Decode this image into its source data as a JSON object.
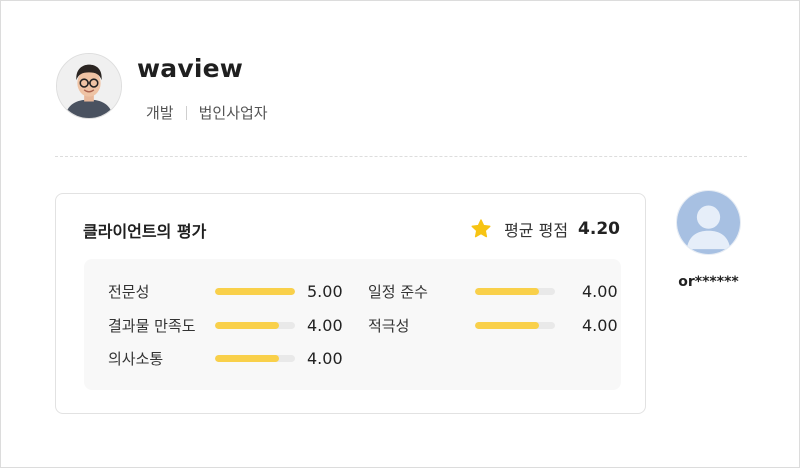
{
  "profile": {
    "name": "waview",
    "category": "개발",
    "business_type": "법인사업자",
    "avatar_icon": "person-photo-icon"
  },
  "review": {
    "title": "클라이언트의 평가",
    "average_label": "평균 평점",
    "average_value": "4.20",
    "star_icon": "star-icon",
    "star_color": "#f7c413",
    "bar_color": "#f9d04a",
    "scores": [
      {
        "label": "전문성",
        "value": "5.00",
        "level": 1.0
      },
      {
        "label": "결과물 만족도",
        "value": "4.00",
        "level": 0.8
      },
      {
        "label": "의사소통",
        "value": "4.00",
        "level": 0.8
      },
      {
        "label": "일정 준수",
        "value": "4.00",
        "level": 0.8
      },
      {
        "label": "적극성",
        "value": "4.00",
        "level": 0.8
      }
    ]
  },
  "reviewer": {
    "name": "or******",
    "avatar_icon": "default-user-icon"
  }
}
